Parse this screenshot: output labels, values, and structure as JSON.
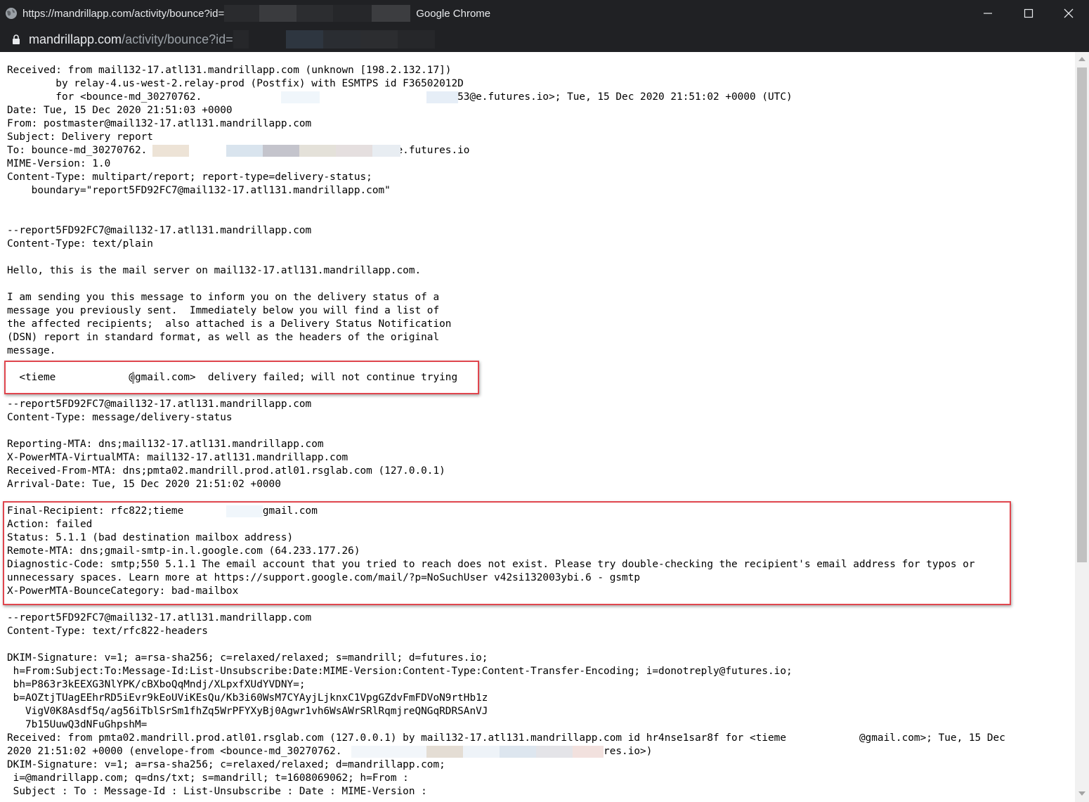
{
  "window": {
    "title_url": "https://mandrillapp.com/activity/bounce?id=",
    "app_name": "Google Chrome"
  },
  "address_bar": {
    "host": "mandrillapp.com",
    "path": "/activity/bounce?id="
  },
  "email": {
    "lines": [
      "Received: from mail132-17.atl131.mandrillapp.com (unknown [198.2.132.17])",
      "        by relay-4.us-west-2.relay-prod (Postfix) with ESMTPS id F36502012D",
      "        for <bounce-md_30270762.                                        9e53@e.futures.io>; Tue, 15 Dec 2020 21:51:02 +0000 (UTC)",
      "Date: Tue, 15 Dec 2020 21:51:03 +0000",
      "From: postmaster@mail132-17.atl131.mandrillapp.com",
      "Subject: Delivery report",
      "To: bounce-md_30270762.                                    9e53@e.futures.io",
      "MIME-Version: 1.0",
      "Content-Type: multipart/report; report-type=delivery-status;",
      "    boundary=\"report5FD92FC7@mail132-17.atl131.mandrillapp.com\"",
      "",
      "",
      "--report5FD92FC7@mail132-17.atl131.mandrillapp.com",
      "Content-Type: text/plain",
      "",
      "Hello, this is the mail server on mail132-17.atl131.mandrillapp.com.",
      "",
      "I am sending you this message to inform you on the delivery status of a",
      "message you previously sent.  Immediately below you will find a list of",
      "the affected recipients;  also attached is a Delivery Status Notification",
      "(DSN) report in standard format, as well as the headers of the original",
      "message.",
      "",
      "  <tieme            @gmail.com>  delivery failed; will not continue trying",
      "",
      "--report5FD92FC7@mail132-17.atl131.mandrillapp.com",
      "Content-Type: message/delivery-status",
      "",
      "Reporting-MTA: dns;mail132-17.atl131.mandrillapp.com",
      "X-PowerMTA-VirtualMTA: mail132-17.atl131.mandrillapp.com",
      "Received-From-MTA: dns;pmta02.mandrill.prod.atl01.rsglab.com (127.0.0.1)",
      "Arrival-Date: Tue, 15 Dec 2020 21:51:02 +0000",
      "",
      "Final-Recipient: rfc822;tieme            @gmail.com",
      "Action: failed",
      "Status: 5.1.1 (bad destination mailbox address)",
      "Remote-MTA: dns;gmail-smtp-in.l.google.com (64.233.177.26)",
      "Diagnostic-Code: smtp;550 5.1.1 The email account that you tried to reach does not exist. Please try double-checking the recipient's email address for typos or",
      "unnecessary spaces. Learn more at https://support.google.com/mail/?p=NoSuchUser v42si132003ybi.6 - gsmtp",
      "X-PowerMTA-BounceCategory: bad-mailbox",
      "",
      "--report5FD92FC7@mail132-17.atl131.mandrillapp.com",
      "Content-Type: text/rfc822-headers",
      "",
      "DKIM-Signature: v=1; a=rsa-sha256; c=relaxed/relaxed; s=mandrill; d=futures.io;",
      " h=From:Subject:To:Message-Id:List-Unsubscribe:Date:MIME-Version:Content-Type:Content-Transfer-Encoding; i=donotreply@futures.io;",
      " bh=P863r3kEEXG3NlYPK/cBXboQqMndj/XLpxfXUdYVDNY=;",
      " b=AOZtjTUagEEhrRD5iEvr9kEoUViKEsQu/Kb3i60WsM7CYAyjLjknxC1VpgGZdvFmFDVoN9rtHb1z",
      "   VigV0K8Asdf5q/ag56iTblSrSm1fhZq5WrPFYXyBj0Agwr1vh6WsAWrSRlRqmjreQNGqRDRSAnVJ",
      "   7b15UuwQ3dNFuGhpshM=",
      "Received: from pmta02.mandrill.prod.atl01.rsglab.com (127.0.0.1) by mail132-17.atl131.mandrillapp.com id hr4nse1sar8f for <tieme            @gmail.com>; Tue, 15 Dec",
      "2020 21:51:02 +0000 (envelope-from <bounce-md_30270762.                                9e53@e.futures.io>)",
      "DKIM-Signature: v=1; a=rsa-sha256; c=relaxed/relaxed; d=mandrillapp.com;",
      " i=@mandrillapp.com; q=dns/txt; s=mandrill; t=1608069062; h=From :",
      " Subject : To : Message-Id : List-Unsubscribe : Date : MIME-Version :"
    ]
  },
  "colors": {
    "chrome_bg": "#202124",
    "highlight_border": "#e0464e",
    "redaction_tint": "#e6eef7"
  }
}
